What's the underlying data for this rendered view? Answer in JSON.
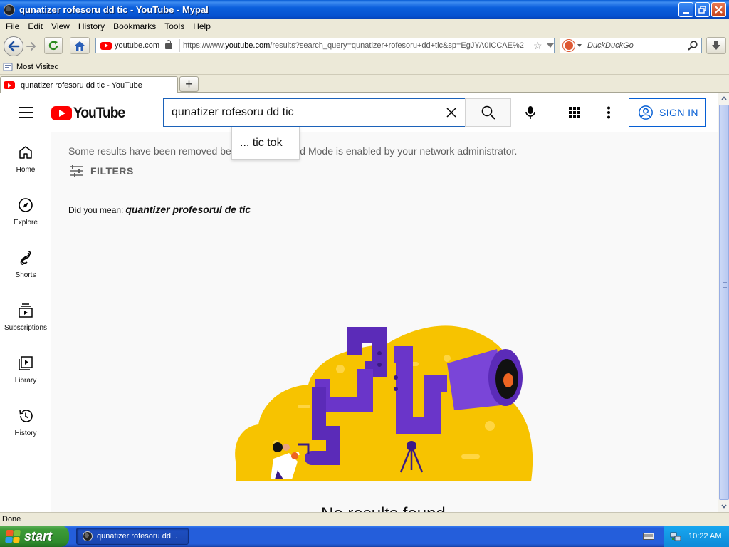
{
  "window": {
    "title": "qunatizer rofesoru dd tic - YouTube - Mypal"
  },
  "menu": [
    "File",
    "Edit",
    "View",
    "History",
    "Bookmarks",
    "Tools",
    "Help"
  ],
  "menu_underline": [
    "F",
    "E",
    "V",
    "H",
    "B",
    "T",
    "H"
  ],
  "navbar": {
    "site_chip": "youtube.com",
    "url_prefix": "https://www.",
    "url_domain": "youtube.com",
    "url_rest": "/results?search_query=qunatizer+rofesoru+dd+tic&sp=EgJYA0ICCAE%2",
    "search_engine_placeholder": "DuckDuckGo"
  },
  "bookmarks": {
    "most_visited": "Most Visited"
  },
  "tab": {
    "title": "qunatizer rofesoru dd tic - YouTube",
    "new_tab": "+"
  },
  "youtube": {
    "logo_text": "YouTube",
    "search_query": "qunatizer rofesoru dd tic",
    "suggestion": "... tic tok",
    "sign_in": "SIGN IN",
    "guide": [
      {
        "label": "Home",
        "icon": "home-icon"
      },
      {
        "label": "Explore",
        "icon": "explore-icon"
      },
      {
        "label": "Shorts",
        "icon": "shorts-icon"
      },
      {
        "label": "Subscriptions",
        "icon": "subscriptions-icon"
      },
      {
        "label": "Library",
        "icon": "library-icon"
      },
      {
        "label": "History",
        "icon": "history-icon"
      }
    ],
    "notice": "Some results have been removed because Restricted Mode is enabled by your network administrator.",
    "filters": "FILTERS",
    "did_you_mean_label": "Did you mean:",
    "did_you_mean_suggestion": "quantizer profesorul de tic",
    "no_results": "No results found"
  },
  "statusbar": {
    "text": "Done"
  },
  "taskbar": {
    "start": "start",
    "task_label": "qunatizer rofesoru dd...",
    "clock": "10:22 AM"
  },
  "colors": {
    "youtube_red": "#ff0000",
    "link_blue": "#065fd4",
    "xp_blue": "#245edb",
    "xp_start_green": "#3d9b37",
    "illustration_yellow": "#f7c300",
    "illustration_purple": "#6a35c9"
  }
}
